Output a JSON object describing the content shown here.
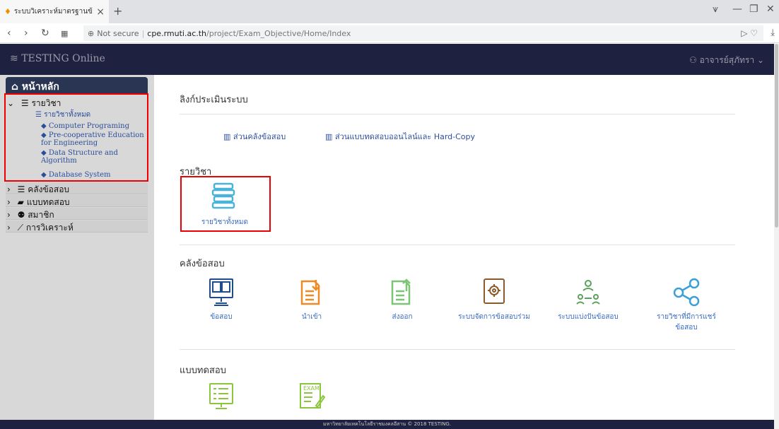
{
  "browser": {
    "tab_title": "ระบบวิเคราะห์มาตรฐานข้อสอบ",
    "new_tab": "+",
    "not_secure": "Not secure",
    "url_domain": "cpe.rmuti.ac.th",
    "url_path": "/project/Exam_Objective/Home/Index"
  },
  "header": {
    "brand": "TESTING Online",
    "user": "อาจารย์สุภัทรา"
  },
  "sidebar": {
    "home": "หน้าหลัก",
    "course_menu": "รายวิชา",
    "course_all": "รายวิชาทั้งหมด",
    "courses": [
      "Computer Programing",
      "Pre-cooperative Education for Engineering",
      "Data Structure and Algorithm",
      "Database System"
    ],
    "menus": [
      "คลังข้อสอบ",
      "แบบทดสอบ",
      "สมาชิก",
      "การวิเคราะห์"
    ]
  },
  "main": {
    "section_eval": "ลิงก์ประเมินระบบ",
    "link_bank": "ส่วนคลังข้อสอบ",
    "link_online": "ส่วนแบบทดสอบออนไลน์และ Hard-Copy",
    "section_course": "รายวิชา",
    "tile_all_courses": "รายวิชาทั้งหมด",
    "section_bank": "คลังข้อสอบ",
    "bank_tiles": [
      "ข้อสอบ",
      "นำเข้า",
      "ส่งออก",
      "ระบบจัดการข้อสอบร่วม",
      "ระบบแบ่งปันข้อสอบ",
      "รายวิชาที่มีการแชร์ข้อสอบ"
    ],
    "section_test": "แบบทดสอบ"
  },
  "footer": "มหาวิทยาลัยเทคโนโลยีราชมงคลอีสาน © 2018 TESTING.",
  "colors": {
    "header": "#1f2140",
    "link": "#2b4e9c",
    "highlight": "#e00000",
    "sidebar": "#d8d8d8"
  }
}
